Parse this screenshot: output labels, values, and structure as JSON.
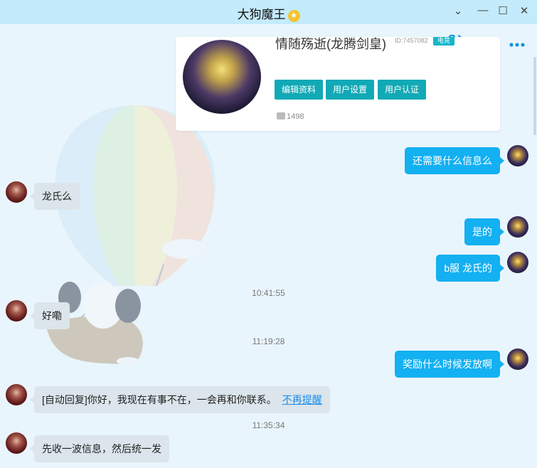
{
  "window": {
    "title": "大狗魔王",
    "controls": {
      "minimize": "⌄",
      "restore": "—",
      "maximize": "☐",
      "close": "✕"
    }
  },
  "toolbar": {
    "icons": [
      "voice-call-icon",
      "video-call-icon",
      "more-icon"
    ]
  },
  "profile_card": {
    "name": "情随殇逝(龙腾剑皇)",
    "id_text": "ID:7457082",
    "tag": "电竞",
    "buttons": [
      "编辑资料",
      "用户设置",
      "用户认证"
    ],
    "likes": "1498"
  },
  "messages": [
    {
      "side": "out",
      "text": "还需要什么信息么"
    },
    {
      "side": "in",
      "text": "龙氏么"
    },
    {
      "side": "out",
      "text": "是的"
    },
    {
      "side": "out",
      "text": "b服 龙氏的"
    },
    {
      "side": "time",
      "text": "10:41:55"
    },
    {
      "side": "in",
      "text": "好嘞"
    },
    {
      "side": "time",
      "text": "11:19:28"
    },
    {
      "side": "out",
      "text": "奖励什么时候发放啊"
    },
    {
      "side": "in",
      "text": "[自动回复]你好，我现在有事不在，一会再和你联系。",
      "link": "不再提醒"
    },
    {
      "side": "time",
      "text": "11:35:34"
    },
    {
      "side": "in",
      "text": "先收一波信息，然后统一发"
    }
  ],
  "colors": {
    "titlebar": "#c4ebfb",
    "background": "#e9f5fc",
    "outgoing_bubble": "#13b0f2",
    "incoming_bubble": "#dbe5eb",
    "accent_button": "#12a9b6",
    "link": "#1a8dea"
  }
}
